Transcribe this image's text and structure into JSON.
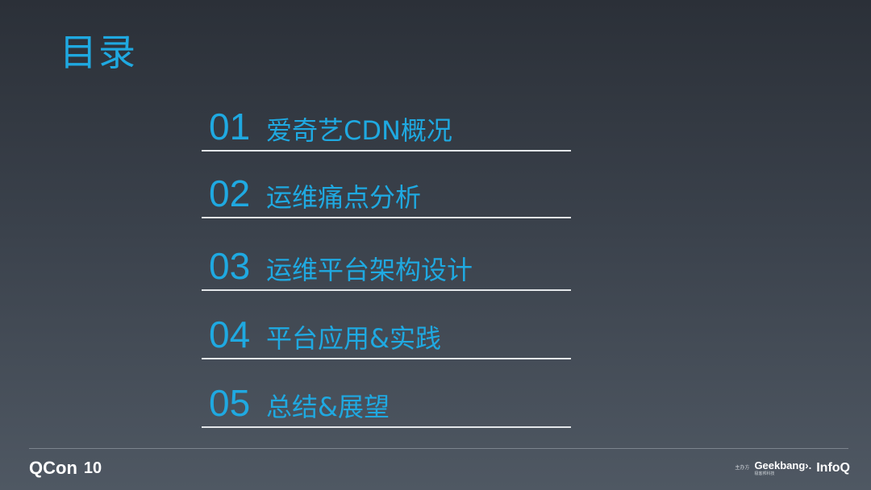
{
  "title": "目录",
  "toc": [
    {
      "num": "01",
      "label": "爱奇艺CDN概况"
    },
    {
      "num": "02",
      "label": "运维痛点分析"
    },
    {
      "num": "03",
      "label": "运维平台架构设计"
    },
    {
      "num": "04",
      "label": "平台应用&实践"
    },
    {
      "num": "05",
      "label": "总结&展望"
    }
  ],
  "footer": {
    "qcon_text": "QCon",
    "qcon_mark": "10",
    "sponsor_label": "主办方",
    "geekbang_text": "Geekbang›.",
    "geekbang_sub": "极客邦科技",
    "infoq_text": "InfoQ"
  },
  "colors": {
    "accent": "#1fa9e1",
    "divider": "#e4e7ea"
  }
}
